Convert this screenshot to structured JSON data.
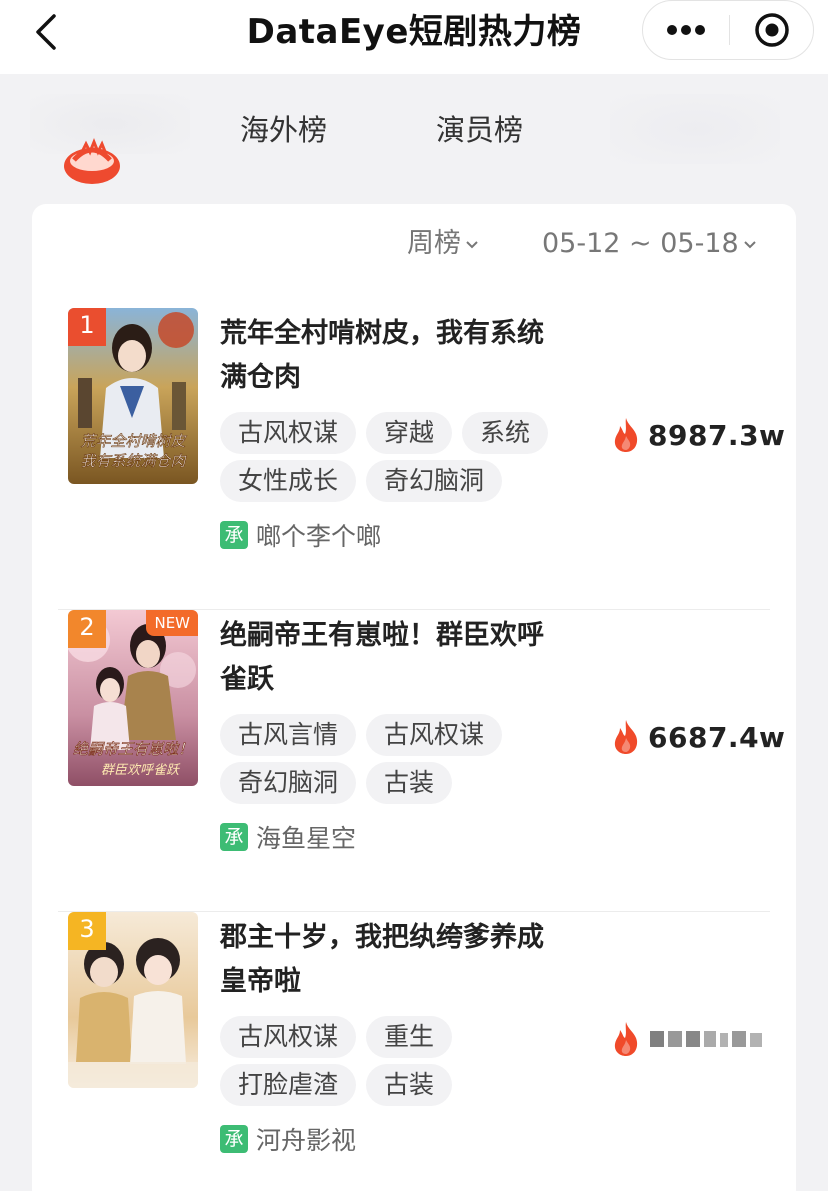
{
  "nav": {
    "title": "DataEye短剧热力榜",
    "back_icon": "chevron-left-icon",
    "more_icon": "more-dots-icon",
    "close_icon": "target-circle-icon"
  },
  "tabs": [
    {
      "label": "海外榜"
    },
    {
      "label": "演员榜"
    }
  ],
  "filters": {
    "period": "周榜",
    "date_range": "05-12 ~ 05-18"
  },
  "colors": {
    "rank1": "#ea4e2f",
    "rank2": "#f2872c",
    "rank3": "#f5b523",
    "producer_badge": "#3dbc74",
    "flame": "#f04a2a"
  },
  "items": [
    {
      "rank": "1",
      "title": "荒年全村啃树皮，我有系统满仓肉",
      "tags": [
        "古风权谋",
        "穿越",
        "系统",
        "女性成长",
        "奇幻脑洞"
      ],
      "heat": "8987.3w",
      "producer_badge": "承",
      "producer": "啷个李个啷",
      "poster_text": "荒年全村啃树皮，我有系统满仓肉"
    },
    {
      "rank": "2",
      "new": "NEW",
      "title": "绝嗣帝王有崽啦！群臣欢呼雀跃",
      "tags": [
        "古风言情",
        "古风权谋",
        "奇幻脑洞",
        "古装"
      ],
      "heat": "6687.4w",
      "producer_badge": "承",
      "producer": "海鱼星空",
      "poster_text": "绝嗣帝王有崽啦！群臣欢呼雀跃"
    },
    {
      "rank": "3",
      "title": "郡主十岁，我把纨绔爹养成皇帝啦",
      "tags": [
        "古风权谋",
        "重生",
        "打脸虐渣",
        "古装"
      ],
      "producer_badge": "承",
      "producer": "河舟影视"
    }
  ]
}
